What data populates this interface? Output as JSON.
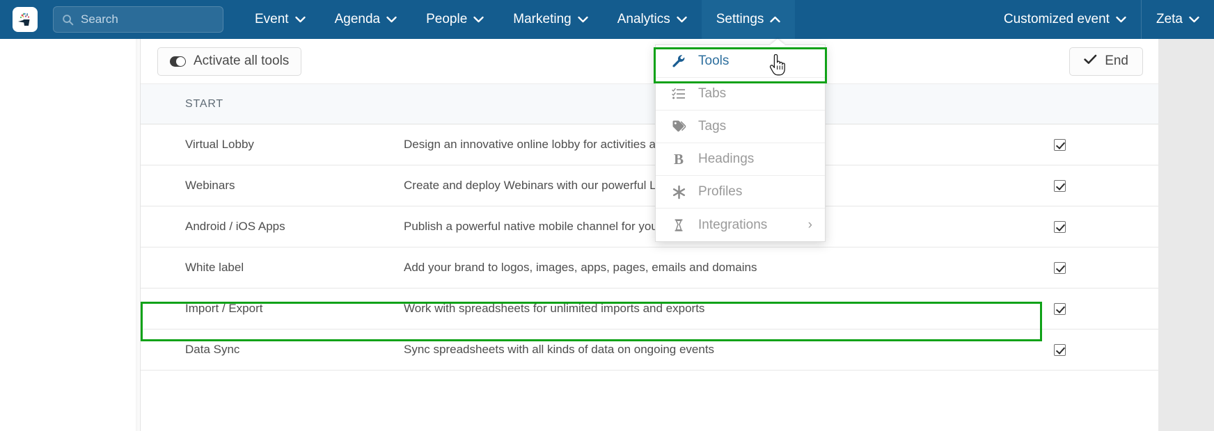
{
  "navbar": {
    "logo_alt": "event-platform-logo",
    "search": {
      "placeholder": "Search",
      "value": ""
    },
    "menus": [
      {
        "label": "Event",
        "caret": "down",
        "active": false
      },
      {
        "label": "Agenda",
        "caret": "down",
        "active": false
      },
      {
        "label": "People",
        "caret": "down",
        "active": false
      },
      {
        "label": "Marketing",
        "caret": "down",
        "active": false
      },
      {
        "label": "Analytics",
        "caret": "down",
        "active": false
      },
      {
        "label": "Settings",
        "caret": "up",
        "active": true
      }
    ],
    "right_menus": [
      {
        "label": "Customized event",
        "caret": "down"
      },
      {
        "label": "Zeta",
        "caret": "down"
      }
    ]
  },
  "dropdown": {
    "open_for": "Settings",
    "highlight_color": "#10a218",
    "items": [
      {
        "label": "Tools",
        "icon": "wrench-icon",
        "highlighted": true,
        "submenu": false
      },
      {
        "label": "Tabs",
        "icon": "list-check-icon",
        "highlighted": false,
        "submenu": false
      },
      {
        "label": "Tags",
        "icon": "tag-icon",
        "highlighted": false,
        "submenu": false
      },
      {
        "label": "Headings",
        "icon": "bold-b-icon",
        "highlighted": false,
        "submenu": false
      },
      {
        "label": "Profiles",
        "icon": "asterisk-icon",
        "highlighted": false,
        "submenu": false
      },
      {
        "label": "Integrations",
        "icon": "plug-icon",
        "highlighted": false,
        "submenu": true,
        "submenu_glyph": "›"
      }
    ]
  },
  "toolbar": {
    "activate_all_label": "Activate all tools",
    "end_label": "End",
    "end_icon": "check-icon",
    "toggle_icon": "toggle-switch-icon"
  },
  "table": {
    "headers": {
      "section": "START",
      "description": "",
      "enabled": ""
    },
    "rows": [
      {
        "name": "Virtual Lobby",
        "description": "Design an innovative online lobby for activities and",
        "checked": true,
        "highlighted": false
      },
      {
        "name": "Webinars",
        "description": "Create and deploy Webinars with our powerful Live",
        "checked": true,
        "highlighted": false
      },
      {
        "name": "Android / iOS Apps",
        "description": "Publish a powerful native mobile channel for your e",
        "checked": true,
        "highlighted": false
      },
      {
        "name": "White label",
        "description": "Add your brand to logos, images, apps, pages, emails and domains",
        "checked": true,
        "highlighted": true
      },
      {
        "name": "Import / Export",
        "description": "Work with spreadsheets for unlimited imports and exports",
        "checked": true,
        "highlighted": false
      },
      {
        "name": "Data Sync",
        "description": "Sync spreadsheets with all kinds of data on ongoing events",
        "checked": true,
        "highlighted": false
      }
    ]
  },
  "cursor": {
    "type": "pointer-hand-cursor"
  },
  "colors": {
    "navbar_bg": "#145c8e",
    "navbar_active_bg": "#1b6596",
    "highlight_green": "#10a218",
    "page_bg": "#e9e9e9",
    "panel_bg": "#ffffff",
    "table_header_bg": "#f7f9fb"
  }
}
